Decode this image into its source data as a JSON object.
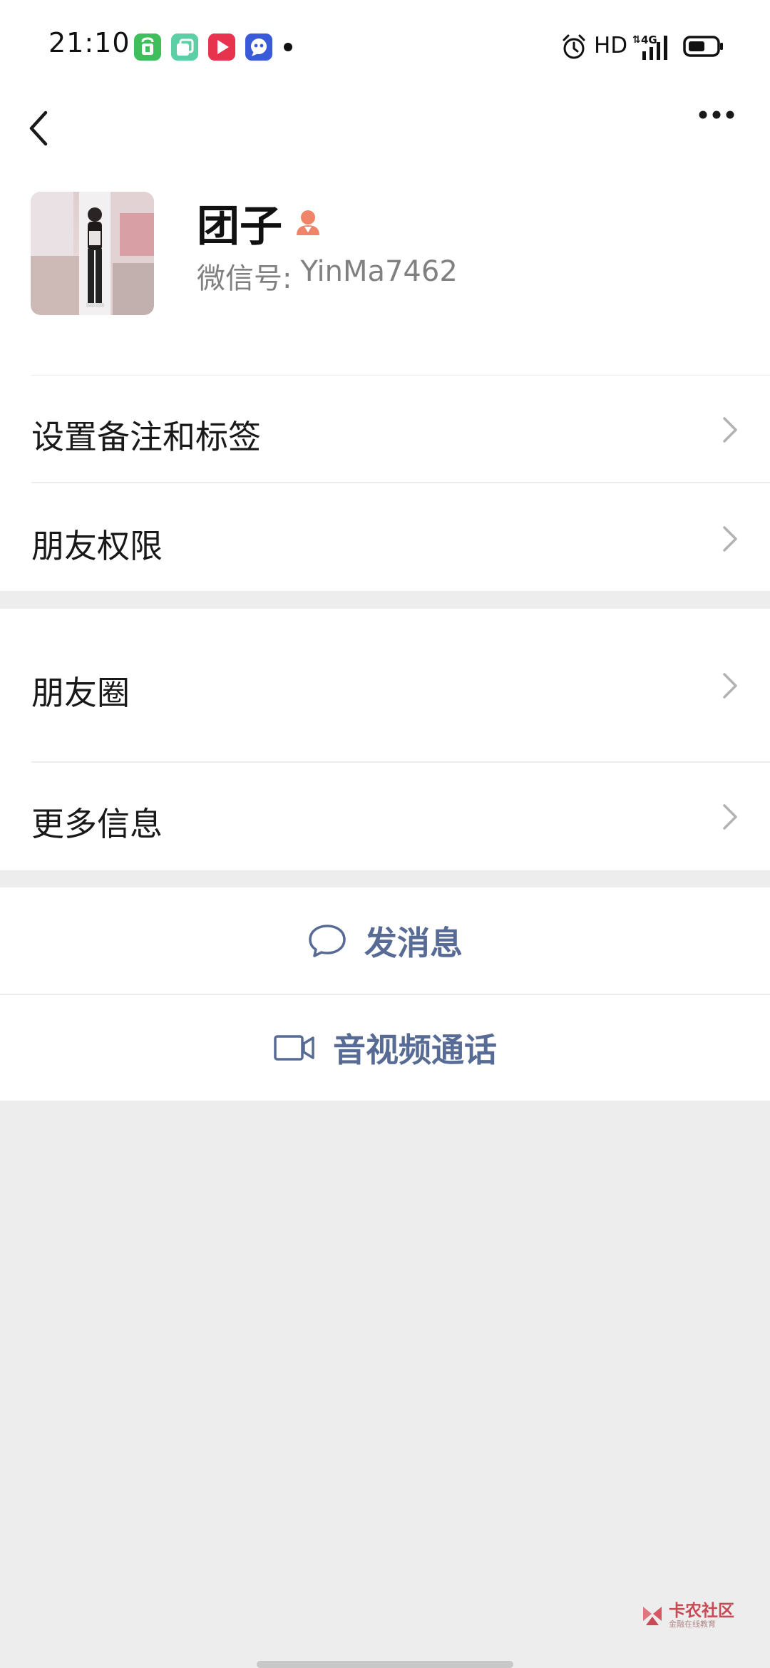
{
  "status_bar": {
    "time": "21:10",
    "hd": "HD",
    "network": "4G",
    "app_icons": [
      "store-app-icon",
      "layers-app-icon",
      "video-app-icon",
      "chat-app-icon"
    ]
  },
  "nav": {
    "back_icon": "chevron-left-icon",
    "more_icon": "more-dots-icon"
  },
  "profile": {
    "name": "团子",
    "gender_icon": "female-icon",
    "wechat_id_label": "微信号:",
    "wechat_id_value": "YinMa7462"
  },
  "group1": {
    "items": [
      {
        "label": "设置备注和标签"
      },
      {
        "label": "朋友权限"
      }
    ]
  },
  "group2": {
    "items": [
      {
        "label": "朋友圈"
      },
      {
        "label": "更多信息"
      }
    ]
  },
  "actions": {
    "message_label": "发消息",
    "call_label": "音视频通话"
  },
  "watermark": {
    "main": "卡农社区",
    "sub": "金融在线教育"
  },
  "colors": {
    "link": "#576b95",
    "background": "#ededed",
    "gender": "#f08468"
  }
}
